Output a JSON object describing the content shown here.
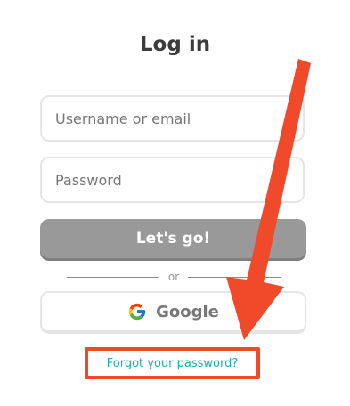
{
  "header": {
    "title": "Log in"
  },
  "form": {
    "username_placeholder": "Username or email",
    "username_value": "",
    "password_placeholder": "Password",
    "password_value": "",
    "submit_label": "Let's go!",
    "divider_text": "or",
    "google_label": "Google",
    "forgot_label": "Forgot your password?"
  },
  "icons": {
    "google": "google-g-icon",
    "annotation": "red-arrow-icon"
  },
  "colors": {
    "button_disabled": "#999999",
    "link": "#1cb0b0",
    "annotation": "#f04a2a"
  }
}
